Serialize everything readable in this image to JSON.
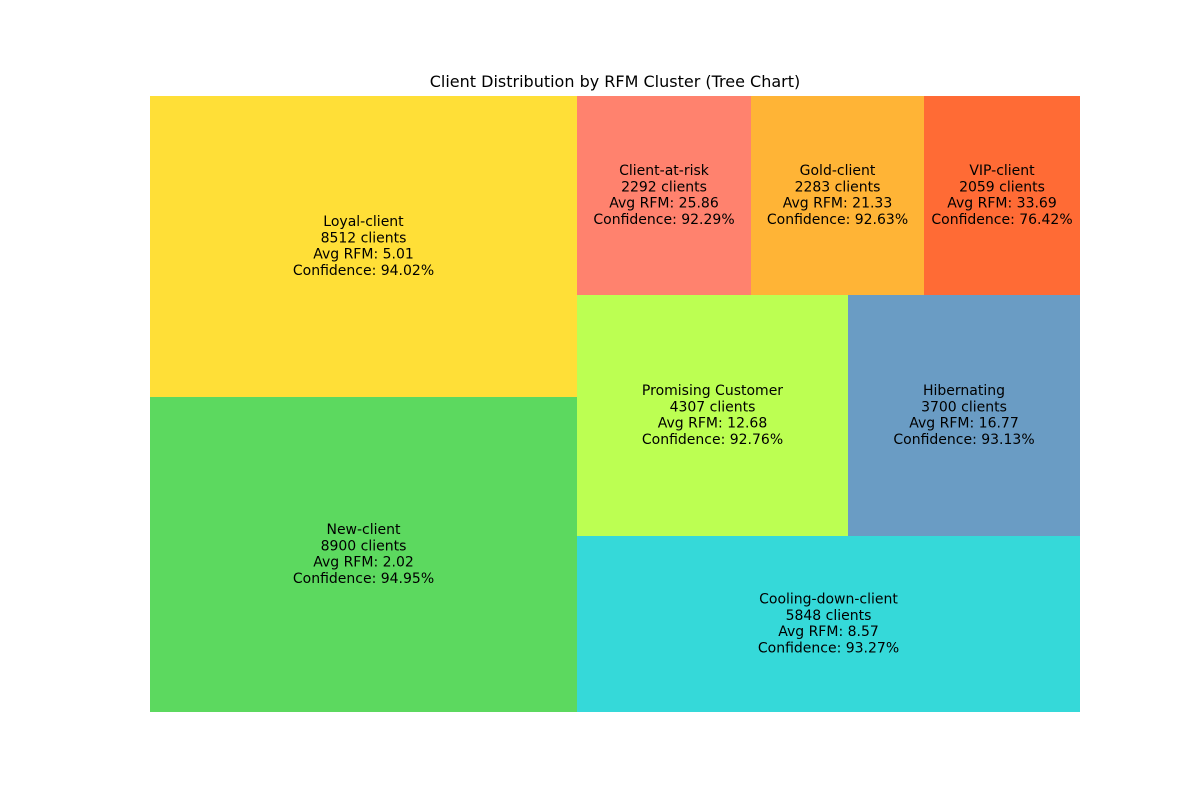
{
  "chart_data": {
    "type": "treemap",
    "title": "Client Distribution by RFM Cluster (Tree Chart)",
    "cells": [
      {
        "name": "Loyal-client",
        "clients_label": "8512 clients",
        "rfm_label": "Avg RFM: 5.01",
        "confidence_label": "Confidence: 94.02%",
        "clients": 8512,
        "avg_rfm": 5.01,
        "confidence": 94.02,
        "color": "#FFDF37"
      },
      {
        "name": "New-client",
        "clients_label": "8900 clients",
        "rfm_label": "Avg RFM: 2.02",
        "confidence_label": "Confidence: 94.95%",
        "clients": 8900,
        "avg_rfm": 2.02,
        "confidence": 94.95,
        "color": "#5CD95F"
      },
      {
        "name": "Client-at-risk",
        "clients_label": "2292 clients",
        "rfm_label": "Avg RFM: 25.86",
        "confidence_label": "Confidence: 92.29%",
        "clients": 2292,
        "avg_rfm": 25.86,
        "confidence": 92.29,
        "color": "#FF826E"
      },
      {
        "name": "Gold-client",
        "clients_label": "2283 clients",
        "rfm_label": "Avg RFM: 21.33",
        "confidence_label": "Confidence: 92.63%",
        "clients": 2283,
        "avg_rfm": 21.33,
        "confidence": 92.63,
        "color": "#FFB436"
      },
      {
        "name": "VIP-client",
        "clients_label": "2059 clients",
        "rfm_label": "Avg RFM: 33.69",
        "confidence_label": "Confidence: 76.42%",
        "clients": 2059,
        "avg_rfm": 33.69,
        "confidence": 76.42,
        "color": "#FF6B35"
      },
      {
        "name": "Promising Customer",
        "clients_label": "4307 clients",
        "rfm_label": "Avg RFM: 12.68",
        "confidence_label": "Confidence: 92.76%",
        "clients": 4307,
        "avg_rfm": 12.68,
        "confidence": 92.76,
        "color": "#BCFF52"
      },
      {
        "name": "Hibernating",
        "clients_label": "3700 clients",
        "rfm_label": "Avg RFM: 16.77",
        "confidence_label": "Confidence: 93.13%",
        "clients": 3700,
        "avg_rfm": 16.77,
        "confidence": 93.13,
        "color": "#6A9CC4"
      },
      {
        "name": "Cooling-down-client",
        "clients_label": "5848 clients",
        "rfm_label": "Avg RFM: 8.57",
        "confidence_label": "Confidence: 93.27%",
        "clients": 5848,
        "avg_rfm": 8.57,
        "confidence": 93.27,
        "color": "#35D9D9"
      }
    ]
  }
}
